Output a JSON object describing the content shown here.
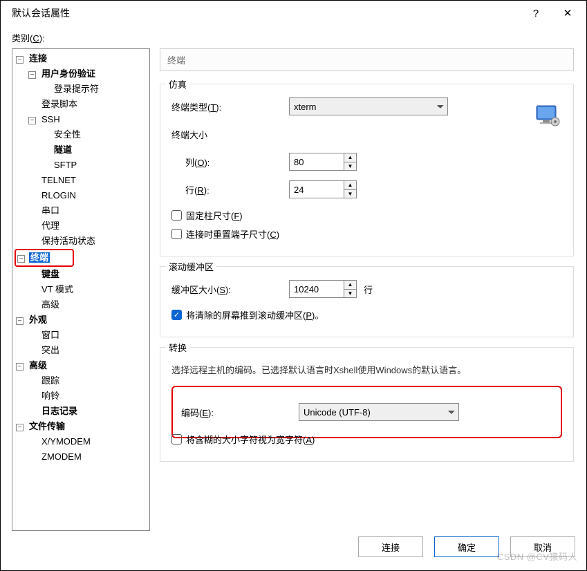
{
  "title": "默认会话属性",
  "titlebar": {
    "help": "?",
    "close": "✕"
  },
  "categoryLabelPrefix": "类别(",
  "categoryLabelKey": "C",
  "categoryLabelSuffix": "):",
  "tree": {
    "connection": "连接",
    "auth": "用户身份验证",
    "loginPrompt": "登录提示符",
    "loginScript": "登录脚本",
    "ssh": "SSH",
    "security": "安全性",
    "tunnel": "隧道",
    "sftp": "SFTP",
    "telnet": "TELNET",
    "rlogin": "RLOGIN",
    "serial": "串口",
    "proxy": "代理",
    "keepalive": "保持活动状态",
    "terminal": "终端",
    "keyboard": "键盘",
    "vtMode": "VT 模式",
    "advanced1": "高级",
    "appearance": "外观",
    "window": "窗口",
    "highlight": "突出",
    "advanced2": "高级",
    "tracking": "跟踪",
    "bell": "响铃",
    "logging": "日志记录",
    "fileTransfer": "文件传输",
    "xymodem": "X/YMODEM",
    "zmodem": "ZMODEM"
  },
  "content": {
    "headerTitle": "终端",
    "simulation": {
      "title": "仿真",
      "termTypeLabelPre": "终端类型(",
      "termTypeKey": "T",
      "termTypeLabelPost": "):",
      "termTypeValue": "xterm",
      "sizeLabel": "终端大小",
      "colsLabelPre": "列(",
      "colsKey": "O",
      "colsLabelPost": "):",
      "colsValue": "80",
      "rowsLabelPre": "行(",
      "rowsKey": "R",
      "rowsLabelPost": "):",
      "rowsValue": "24",
      "fixedColsPre": "固定柱尺寸(",
      "fixedColsKey": "F",
      "fixedColsPost": ")",
      "resetOnConnectPre": "连接时重置端子尺寸(",
      "resetOnConnectKey": "C",
      "resetOnConnectPost": ")"
    },
    "scroll": {
      "title": "滚动缓冲区",
      "bufLabelPre": "缓冲区大小(",
      "bufKey": "S",
      "bufLabelPost": "):",
      "bufValue": "10240",
      "bufUnit": "行",
      "pushPre": "将清除的屏幕推到滚动缓冲区(",
      "pushKey": "P",
      "pushPost": ")。"
    },
    "translate": {
      "title": "转换",
      "desc": "选择远程主机的编码。已选择默认语言时Xshell使用Windows的默认语言。",
      "encLabelPre": "编码(",
      "encKey": "E",
      "encLabelPost": "):",
      "encValue": "Unicode (UTF-8)",
      "ambPre": "将含糊的大小字符视为宽字符(",
      "ambKey": "A",
      "ambPost": ")"
    }
  },
  "buttons": {
    "connect": "连接",
    "ok": "确定",
    "cancel": "取消"
  },
  "watermark": "CSDN @CV猿码人"
}
